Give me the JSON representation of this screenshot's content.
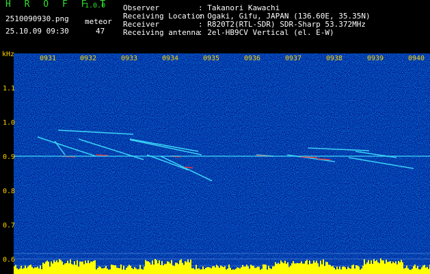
{
  "header": {
    "app_title": "H R O F F T",
    "app_version": "1.0.0",
    "file_name": "2510090930.png",
    "datetime": "25.10.09 09:30",
    "meteor_label": "meteor",
    "meteor_count": "47",
    "info": [
      {
        "label": "Observer",
        "value": ": Takanori Kawachi"
      },
      {
        "label": "Receiving Location",
        "value": ": Ogaki, Gifu, JAPAN (136.60E, 35.35N)"
      },
      {
        "label": "Receiver",
        "value": ": R820T2(RTL-SDR) SDR-Sharp 53.372MHz"
      },
      {
        "label": "Receiving antenna",
        "value": ": 2el-HB9CV Vertical (el. E-W)"
      }
    ]
  },
  "spectrogram": {
    "unit_label": "kHz",
    "y_labels": [
      "1.1",
      "1.0",
      "0.9",
      "0.8",
      "0.7",
      "0.6"
    ],
    "x_labels": [
      "0931",
      "0932",
      "0933",
      "0934",
      "0935",
      "0936",
      "0937",
      "0938",
      "0939",
      "0940"
    ],
    "carrier_khz": 0.9,
    "colors": {
      "background": "#0a1a9a",
      "text_green": "#2fe02f",
      "label_yellow": "#ffd400",
      "echo_trace": "#40e0ff",
      "echo_core": "#ff3030",
      "level_bar": "#ffff00"
    }
  }
}
